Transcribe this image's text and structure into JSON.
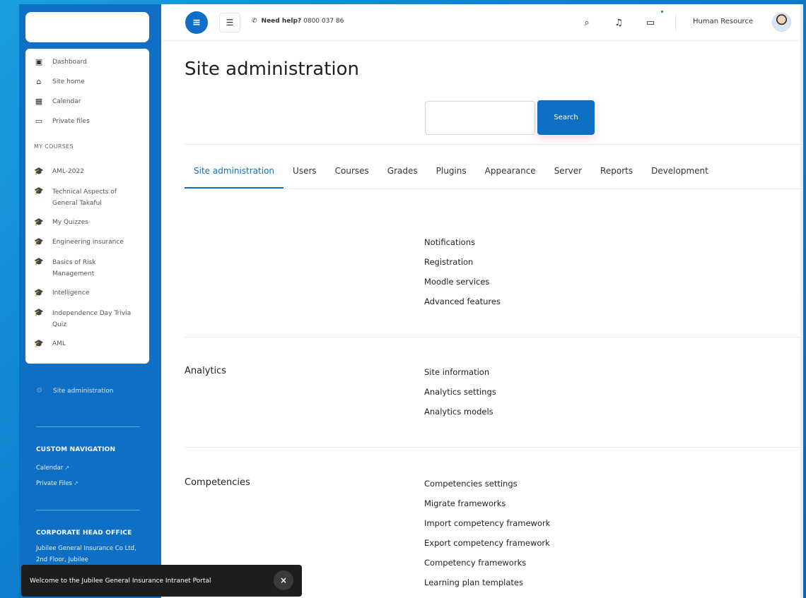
{
  "sidebar": {
    "items": [
      {
        "label": "Dashboard",
        "icon": "dashboard-icon"
      },
      {
        "label": "Site home",
        "icon": "home-icon"
      },
      {
        "label": "Calendar",
        "icon": "calendar-icon"
      },
      {
        "label": "Private files",
        "icon": "files-icon"
      }
    ],
    "my_courses_heading": "MY COURSES",
    "courses": [
      "AML-2022",
      "Technical Aspects of General Takaful",
      "My Quizzes",
      "Engineering insurance",
      "Basics of Risk Management",
      "Intelligence",
      "Independence Day Trivia Quiz",
      "AML"
    ],
    "site_admin": "Site administration",
    "custom_nav_heading": "CUSTOM NAVIGATION",
    "custom_nav_links": [
      "Calendar",
      "Private Files"
    ],
    "office_heading": "CORPORATE HEAD OFFICE",
    "office_text": "Jubilee General Insurance Co Ltd, 2nd Floor, Jubilee"
  },
  "topbar": {
    "help_label": "Need help?",
    "help_phone": "0800 037 86",
    "user_name": "Human Resource"
  },
  "main": {
    "page_title": "Site administration",
    "search_button": "Search",
    "search_placeholder": "",
    "tabs": [
      {
        "label": "Site administration",
        "active": true
      },
      {
        "label": "Users"
      },
      {
        "label": "Courses"
      },
      {
        "label": "Grades"
      },
      {
        "label": "Plugins"
      },
      {
        "label": "Appearance"
      },
      {
        "label": "Server"
      },
      {
        "label": "Reports"
      },
      {
        "label": "Development"
      }
    ],
    "general_links": [
      "Notifications",
      "Registration",
      "Moodle services",
      "Advanced features"
    ],
    "analytics": {
      "title": "Analytics",
      "links": [
        "Site information",
        "Analytics settings",
        "Analytics models"
      ]
    },
    "competencies": {
      "title": "Competencies",
      "links": [
        "Competencies settings",
        "Migrate frameworks",
        "Import competency framework",
        "Export competency framework",
        "Competency frameworks",
        "Learning plan templates"
      ]
    }
  },
  "toast": {
    "message": "Welcome to the Jubilee General Insurance Intranet Portal",
    "close_symbol": "×"
  },
  "colors": {
    "brand_blue": "#0f6fc5",
    "background_blue": "#1aa0e0"
  }
}
